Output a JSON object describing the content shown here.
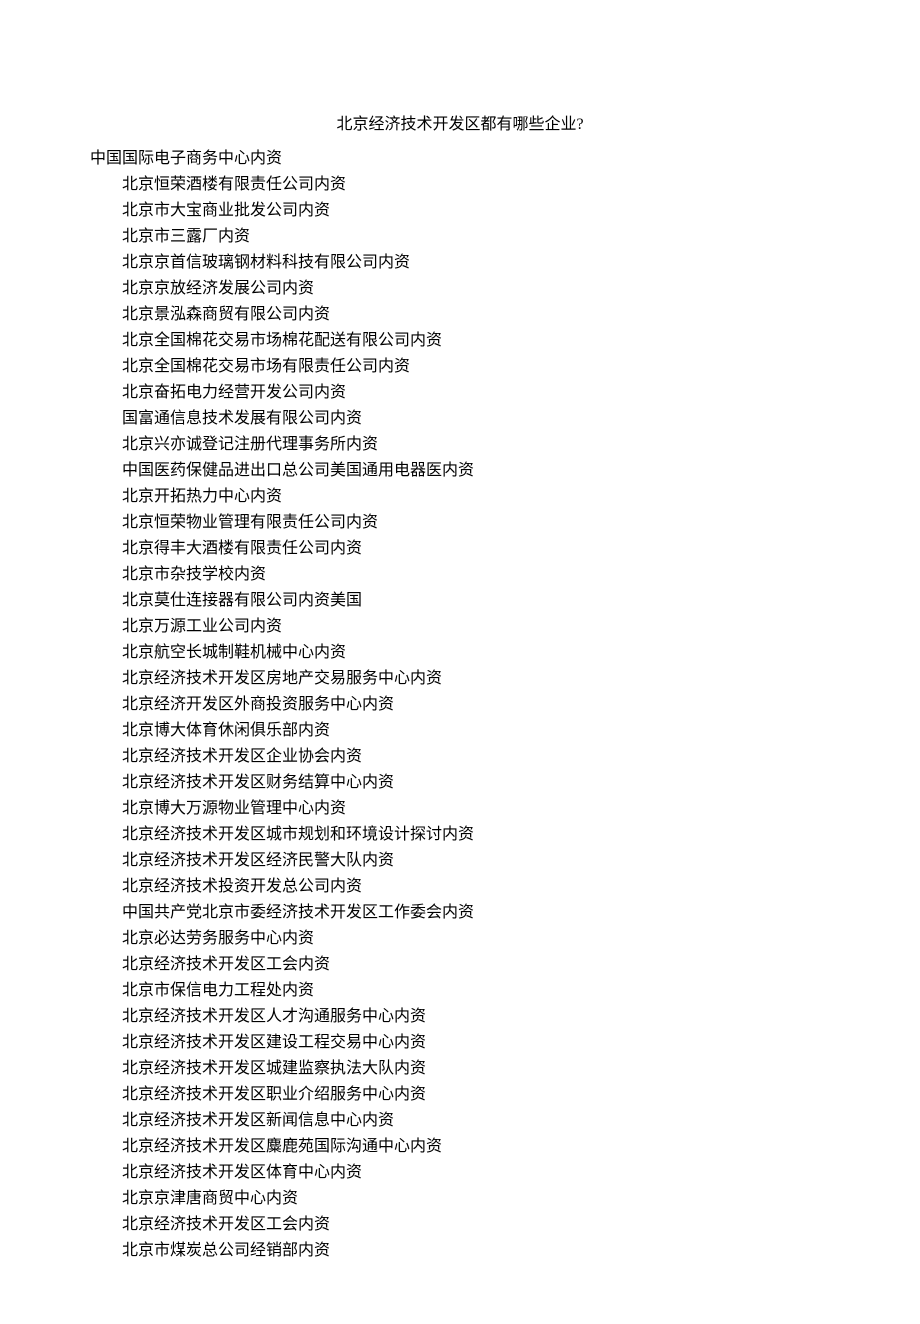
{
  "title": "北京经济技术开发区都有哪些企业?",
  "first_line": "中国国际电子商务中心内资",
  "items": [
    "北京恒荣酒楼有限责任公司内资",
    "北京市大宝商业批发公司内资",
    "北京市三露厂内资",
    "北京京首信玻璃钢材料科技有限公司内资",
    "北京京放经济发展公司内资",
    "北京景泓森商贸有限公司内资",
    "北京全国棉花交易市场棉花配送有限公司内资",
    "北京全国棉花交易市场有限责任公司内资",
    "北京奋拓电力经营开发公司内资",
    "国富通信息技术发展有限公司内资",
    "北京兴亦诚登记注册代理事务所内资",
    "中国医药保健品进出口总公司美国通用电器医内资",
    "北京开拓热力中心内资",
    "北京恒荣物业管理有限责任公司内资",
    "北京得丰大酒楼有限责任公司内资",
    "北京市杂技学校内资",
    "北京莫仕连接器有限公司内资美国",
    "北京万源工业公司内资",
    "北京航空长城制鞋机械中心内资",
    "北京经济技术开发区房地产交易服务中心内资",
    "北京经济开发区外商投资服务中心内资",
    "北京博大体育休闲俱乐部内资",
    "北京经济技术开发区企业协会内资",
    "北京经济技术开发区财务结算中心内资",
    "北京博大万源物业管理中心内资",
    "北京经济技术开发区城市规划和环境设计探讨内资",
    "北京经济技术开发区经济民警大队内资",
    "北京经济技术投资开发总公司内资",
    "中国共产党北京市委经济技术开发区工作委会内资",
    "北京必达劳务服务中心内资",
    "北京经济技术开发区工会内资",
    "北京市保信电力工程处内资",
    "北京经济技术开发区人才沟通服务中心内资",
    "北京经济技术开发区建设工程交易中心内资",
    "北京经济技术开发区城建监察执法大队内资",
    "北京经济技术开发区职业介绍服务中心内资",
    "北京经济技术开发区新闻信息中心内资",
    "北京经济技术开发区麋鹿苑国际沟通中心内资",
    "北京经济技术开发区体育中心内资",
    "北京京津唐商贸中心内资",
    "北京经济技术开发区工会内资",
    "北京市煤炭总公司经销部内资"
  ]
}
